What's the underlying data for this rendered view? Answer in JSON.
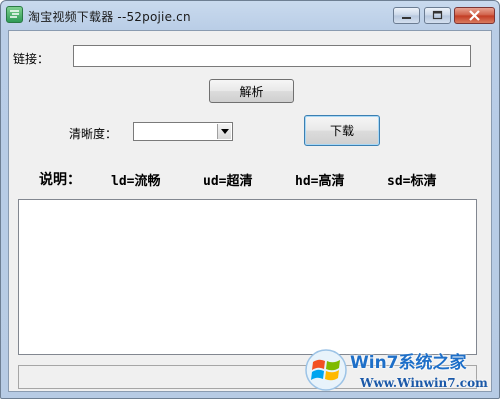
{
  "window": {
    "title": "淘宝视频下载器  --52pojie.cn",
    "controls": [
      "minimize",
      "maximize",
      "close"
    ]
  },
  "form": {
    "link_label": "链接：",
    "link_value": "",
    "parse_button": "解析",
    "quality_label": "清晰度：",
    "quality_selected": "",
    "download_button": "下载"
  },
  "legend": {
    "title": "说明：",
    "items": [
      "ld=流畅",
      "ud=超清",
      "hd=高清",
      "sd=标清"
    ]
  },
  "output": {
    "text": ""
  },
  "status": {
    "text": ""
  },
  "watermark": {
    "title": "Win7系统之家",
    "url": "Www.Winwin7.com"
  },
  "colors": {
    "titlebar": "#c9daee",
    "client": "#f0f0f0",
    "close_button": "#c23a22",
    "watermark_blue": "#1e6fc8"
  },
  "icons": {
    "app": "app-icon",
    "minimize": "minimize-icon",
    "maximize": "maximize-icon",
    "close": "close-icon",
    "dropdown": "chevron-down-icon",
    "watermark": "windows-logo-icon"
  }
}
